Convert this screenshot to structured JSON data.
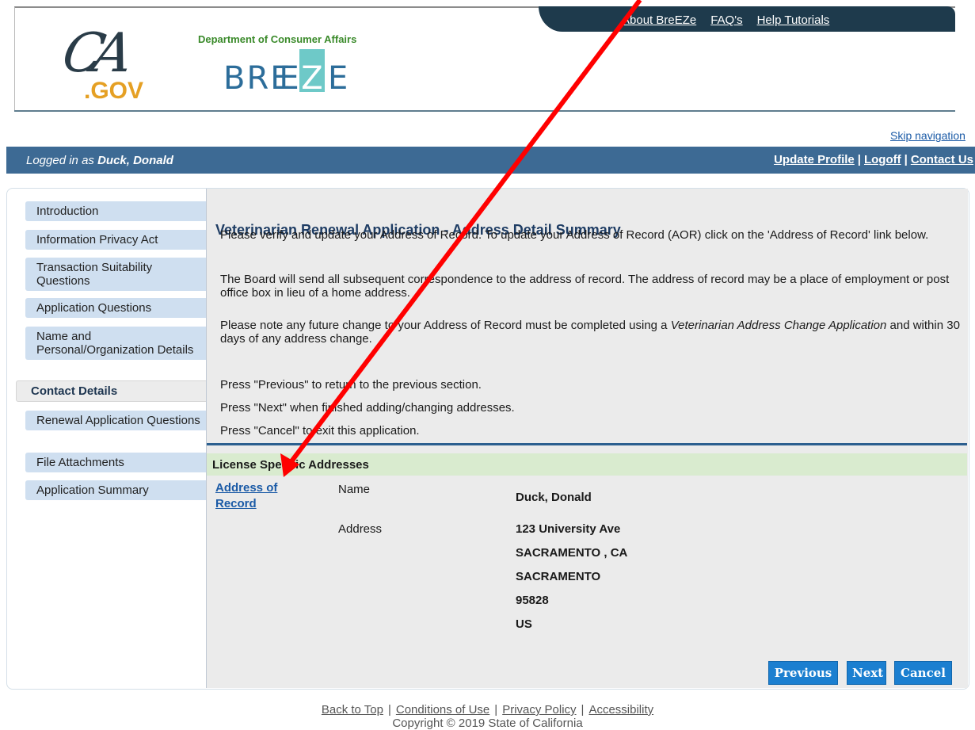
{
  "header": {
    "top_links": [
      "About BreEZe",
      "FAQ's",
      "Help Tutorials"
    ],
    "ca_logo_text": "CA",
    "ca_logo_gov": ".GOV",
    "dca_text": "Department of Consumer Affairs",
    "breeze_text_left": "BRE",
    "breeze_text_z": "Z",
    "breeze_text_e2": "E",
    "breeze_text_right": "E",
    "skip_navigation": "Skip navigation"
  },
  "user_bar": {
    "logged_in_prefix": "Logged in as ",
    "user_name": "Duck, Donald",
    "update_profile": "Update Profile",
    "logoff": "Logoff",
    "contact_us": "Contact Us",
    "separator": "|"
  },
  "sidebar": {
    "items": [
      {
        "label": "Introduction"
      },
      {
        "label": "Information Privacy Act"
      },
      {
        "label": "Transaction Suitability Questions"
      },
      {
        "label": "Application Questions"
      },
      {
        "label": "Name and Personal/Organization Details"
      },
      {
        "label": "Contact Details"
      },
      {
        "label": "Renewal Application Questions"
      },
      {
        "label": "File Attachments"
      },
      {
        "label": "Application Summary"
      }
    ],
    "active_index": 5
  },
  "main": {
    "title": "Veterinarian Renewal Application - Address Detail Summary",
    "para1": "Please verify and update your Address of Record. To update your Address of Record (AOR) click on the 'Address of Record' link below.",
    "para2": "The Board will send all subsequent correspondence to the address of record. The address of record may be a place of employment or post office box in lieu of a home address.",
    "para3_pre": "Please note any future change to your Address of Record must be completed using a ",
    "para3_em": "Veterinarian Address Change Application",
    "para3_post": " and within 30 days of any address change.",
    "instr_previous": "Press \"Previous\" to return to the previous section.",
    "instr_next": "Press \"Next\" when finished adding/changing addresses.",
    "instr_cancel": "Press \"Cancel\" to exit this application.",
    "section_title": "License Specific Addresses",
    "aor_link": "Address of Record",
    "name_label": "Name",
    "name_value": "Duck, Donald",
    "address_label": "Address",
    "address_lines": [
      "123 University Ave",
      "SACRAMENTO , CA",
      "SACRAMENTO",
      "95828",
      "US"
    ],
    "buttons": {
      "previous": "Previous",
      "next": "Next",
      "cancel": "Cancel"
    }
  },
  "footer": {
    "links": [
      "Back to Top",
      "Conditions of Use",
      "Privacy Policy",
      "Accessibility"
    ],
    "separator": "|",
    "copyright": "Copyright © 2019 State of California"
  },
  "annotation": {
    "arrow_color": "#ff0000"
  }
}
